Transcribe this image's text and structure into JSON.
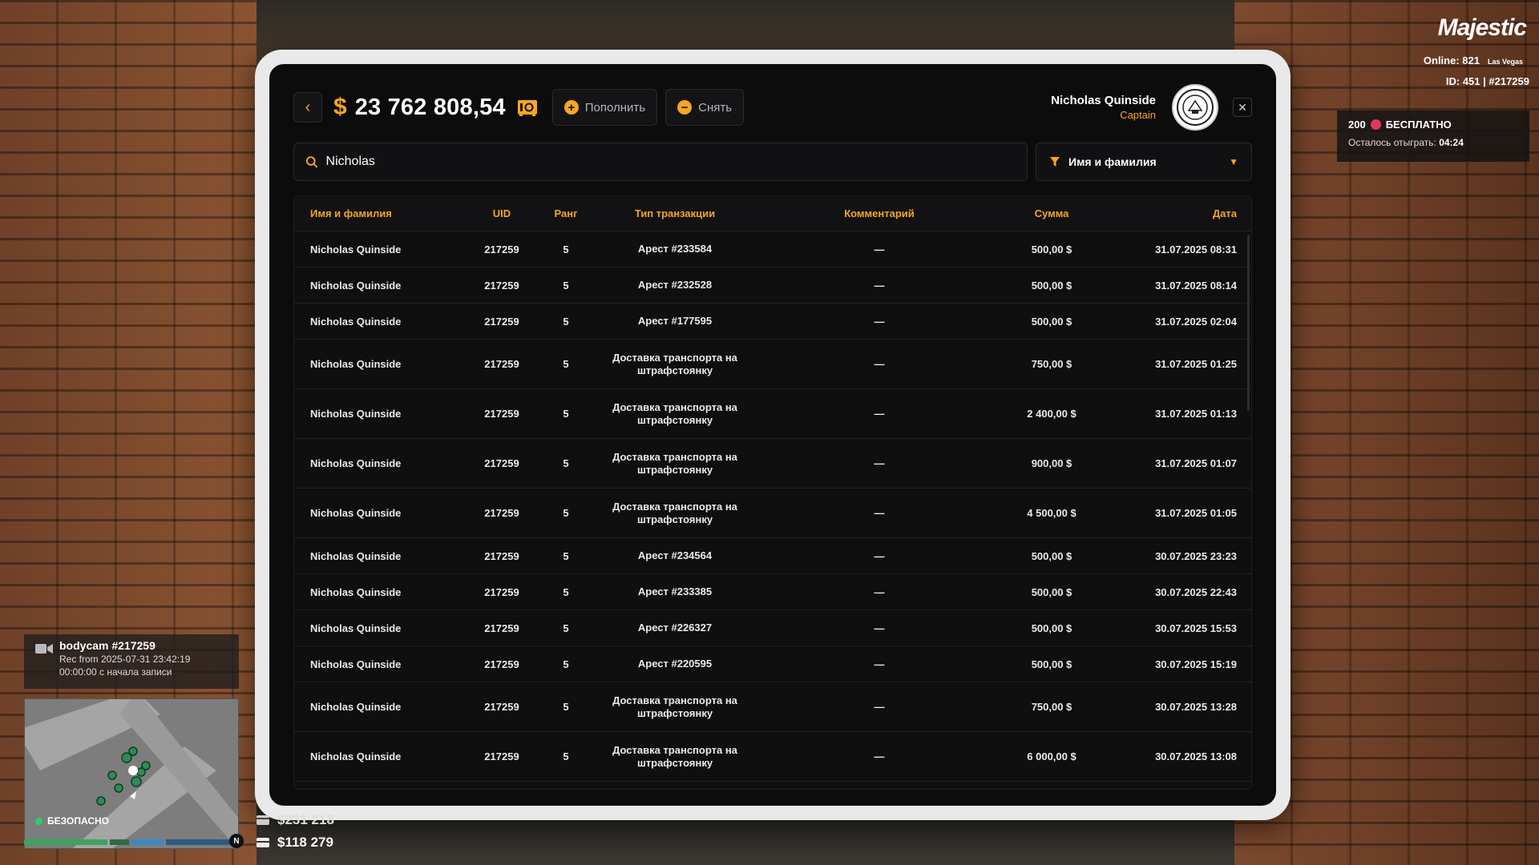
{
  "header": {
    "currency_symbol": "$",
    "balance": "23 762 808,54",
    "deposit_label": "Пополнить",
    "withdraw_label": "Снять",
    "user_name": "Nicholas Quinside",
    "user_rank": "Captain"
  },
  "search": {
    "value": "Nicholas",
    "filter_label": "Имя и фамилия"
  },
  "table": {
    "columns": [
      "Имя и фамилия",
      "UID",
      "Ранг",
      "Тип транзакции",
      "Комментарий",
      "Сумма",
      "Дата"
    ],
    "rows": [
      {
        "name": "Nicholas Quinside",
        "uid": "217259",
        "rank": "5",
        "type": "Арест #233584",
        "comment": "—",
        "sum": "500,00 $",
        "date": "31.07.2025 08:31"
      },
      {
        "name": "Nicholas Quinside",
        "uid": "217259",
        "rank": "5",
        "type": "Арест #232528",
        "comment": "—",
        "sum": "500,00 $",
        "date": "31.07.2025 08:14"
      },
      {
        "name": "Nicholas Quinside",
        "uid": "217259",
        "rank": "5",
        "type": "Арест #177595",
        "comment": "—",
        "sum": "500,00 $",
        "date": "31.07.2025 02:04"
      },
      {
        "name": "Nicholas Quinside",
        "uid": "217259",
        "rank": "5",
        "type": "Доставка транспорта на штрафстоянку",
        "comment": "—",
        "sum": "750,00 $",
        "date": "31.07.2025 01:25"
      },
      {
        "name": "Nicholas Quinside",
        "uid": "217259",
        "rank": "5",
        "type": "Доставка транспорта на штрафстоянку",
        "comment": "—",
        "sum": "2 400,00 $",
        "date": "31.07.2025 01:13"
      },
      {
        "name": "Nicholas Quinside",
        "uid": "217259",
        "rank": "5",
        "type": "Доставка транспорта на штрафстоянку",
        "comment": "—",
        "sum": "900,00 $",
        "date": "31.07.2025 01:07"
      },
      {
        "name": "Nicholas Quinside",
        "uid": "217259",
        "rank": "5",
        "type": "Доставка транспорта на штрафстоянку",
        "comment": "—",
        "sum": "4 500,00 $",
        "date": "31.07.2025 01:05"
      },
      {
        "name": "Nicholas Quinside",
        "uid": "217259",
        "rank": "5",
        "type": "Арест #234564",
        "comment": "—",
        "sum": "500,00 $",
        "date": "30.07.2025 23:23"
      },
      {
        "name": "Nicholas Quinside",
        "uid": "217259",
        "rank": "5",
        "type": "Арест #233385",
        "comment": "—",
        "sum": "500,00 $",
        "date": "30.07.2025 22:43"
      },
      {
        "name": "Nicholas Quinside",
        "uid": "217259",
        "rank": "5",
        "type": "Арест #226327",
        "comment": "—",
        "sum": "500,00 $",
        "date": "30.07.2025 15:53"
      },
      {
        "name": "Nicholas Quinside",
        "uid": "217259",
        "rank": "5",
        "type": "Арест #220595",
        "comment": "—",
        "sum": "500,00 $",
        "date": "30.07.2025 15:19"
      },
      {
        "name": "Nicholas Quinside",
        "uid": "217259",
        "rank": "5",
        "type": "Доставка транспорта на штрафстоянку",
        "comment": "—",
        "sum": "750,00 $",
        "date": "30.07.2025 13:28"
      },
      {
        "name": "Nicholas Quinside",
        "uid": "217259",
        "rank": "5",
        "type": "Доставка транспорта на штрафстоянку",
        "comment": "—",
        "sum": "6 000,00 $",
        "date": "30.07.2025 13:08"
      }
    ]
  },
  "hud": {
    "logo": "Majestic",
    "online_label": "Online: 821",
    "server": "Las Vegas",
    "id_label": "ID: 451 | #217259",
    "promo_count": "200",
    "promo_title": "БЕСПЛАТНО",
    "promo_remaining_label": "Осталось отыграть:",
    "promo_time": "04:24",
    "bodycam_title": "bodycam #217259",
    "bodycam_rec": "Rec from 2025-07-31 23:42:19",
    "bodycam_elapsed": "00:00:00 с начала записи",
    "zone_status": "БЕЗОПАСНО",
    "compass": "N",
    "money_bank": "$231 218",
    "money_cash": "$118 279"
  },
  "colors": {
    "accent": "#f5a623",
    "panel": "#0c0c0d",
    "safe": "#2ecc71"
  }
}
